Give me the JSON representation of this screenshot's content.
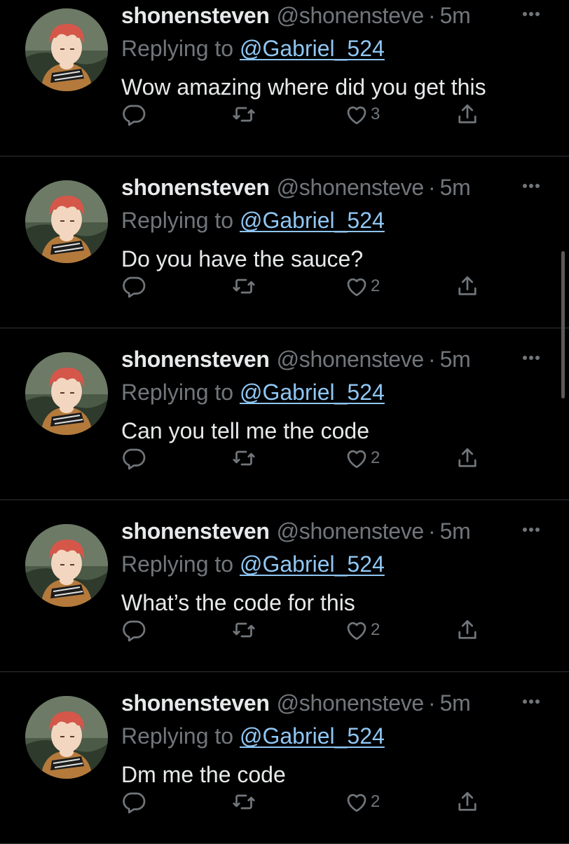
{
  "colors": {
    "background": "#000000",
    "text": "#e7e9ea",
    "muted": "#71767b",
    "mention": "#8fc6f3",
    "divider": "#2f3336"
  },
  "icons": {
    "reply": "speech-bubble-icon",
    "retweet": "retweet-icon",
    "like": "heart-icon",
    "share": "share-icon",
    "more": "more-dots-icon"
  },
  "tweets": [
    {
      "name": "shonensteven",
      "handle": "@shonensteve",
      "separator": "·",
      "time": "5m",
      "replying_label": "Replying to",
      "replying_to": "@Gabriel_524",
      "text": "Wow amazing where did you get this",
      "likes": "3"
    },
    {
      "name": "shonensteven",
      "handle": "@shonensteve",
      "separator": "·",
      "time": "5m",
      "replying_label": "Replying to",
      "replying_to": "@Gabriel_524",
      "text": "Do you have the sauce?",
      "likes": "2"
    },
    {
      "name": "shonensteven",
      "handle": "@shonensteve",
      "separator": "·",
      "time": "5m",
      "replying_label": "Replying to",
      "replying_to": "@Gabriel_524",
      "text": "Can you tell me the code",
      "likes": "2"
    },
    {
      "name": "shonensteven",
      "handle": "@shonensteve",
      "separator": "·",
      "time": "5m",
      "replying_label": "Replying to",
      "replying_to": "@Gabriel_524",
      "text": "What’s the code for this",
      "likes": "2"
    },
    {
      "name": "shonensteven",
      "handle": "@shonensteve",
      "separator": "·",
      "time": "5m",
      "replying_label": "Replying to",
      "replying_to": "@Gabriel_524",
      "text": "Dm me the code",
      "likes": "2"
    }
  ]
}
